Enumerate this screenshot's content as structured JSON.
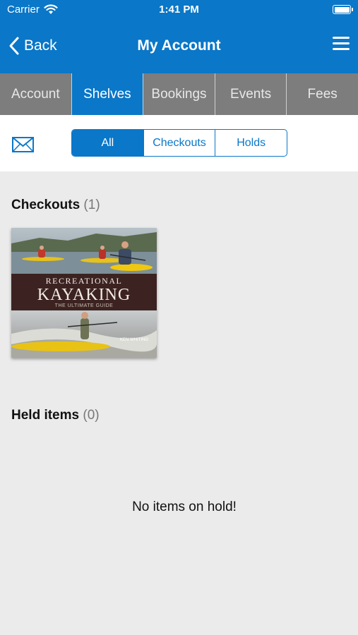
{
  "status_bar": {
    "carrier": "Carrier",
    "time": "1:41 PM"
  },
  "nav": {
    "back_label": "Back",
    "title": "My Account"
  },
  "tabs": [
    {
      "label": "Account",
      "active": false
    },
    {
      "label": "Shelves",
      "active": true
    },
    {
      "label": "Bookings",
      "active": false
    },
    {
      "label": "Events",
      "active": false
    },
    {
      "label": "Fees",
      "active": false
    }
  ],
  "filter": {
    "options": [
      "All",
      "Checkouts",
      "Holds"
    ],
    "selected": "All"
  },
  "checkouts": {
    "title": "Checkouts",
    "count": "(1)",
    "items": [
      {
        "cover_line1": "RECREATIONAL",
        "cover_line2": "KAYAKING",
        "cover_line3": "THE ULTIMATE GUIDE",
        "cover_author": "KEN WHITING"
      }
    ]
  },
  "held": {
    "title": "Held items",
    "count": "(0)",
    "empty_message": "No items on hold!"
  },
  "colors": {
    "brand": "#0a77c8",
    "tab_inactive": "#7d7d7d",
    "background": "#ebebeb"
  }
}
